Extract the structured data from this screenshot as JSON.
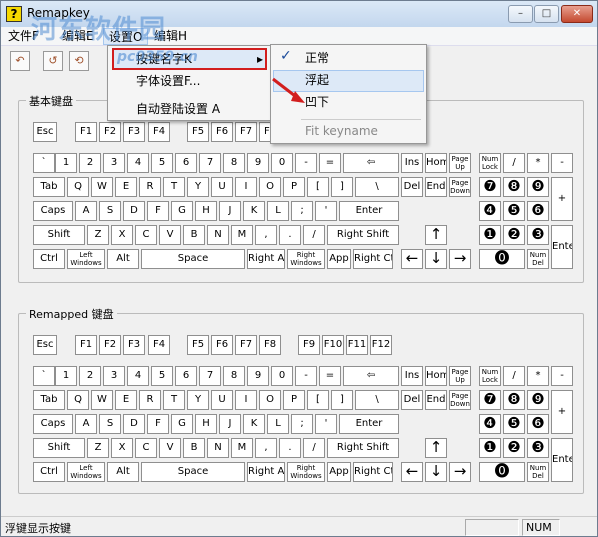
{
  "window": {
    "title": "Remapkey",
    "icon_glyph": "?",
    "min": "–",
    "max": "□",
    "close": "✕"
  },
  "watermark": {
    "text": "河东软件园",
    "url": "pc0359.cn"
  },
  "menubar": [
    "文件F",
    "编辑E",
    "设置O",
    "编辑H"
  ],
  "toolbar": [
    {
      "icon": "open-icon",
      "glyph": "↶"
    },
    {
      "icon": "undo-icon",
      "glyph": "↺"
    },
    {
      "icon": "redo-icon",
      "glyph": "⟲"
    }
  ],
  "settings_menu": {
    "items": [
      "按键名字K",
      "字体设置F...",
      "自动登陆设置 A"
    ],
    "submenu_arrow": "▸"
  },
  "keyname_submenu": {
    "items": [
      "正常",
      "浮起",
      "凹下",
      "Fit keyname"
    ],
    "checked_glyph": "✓"
  },
  "groups": {
    "base_title": "基本键盘",
    "remapped_title": "Remapped 键盘"
  },
  "status": {
    "text": "浮键显示按键",
    "num": "NUM"
  },
  "keys": {
    "fn": [
      "Esc",
      "F1",
      "F2",
      "F3",
      "F4",
      "F5",
      "F6",
      "F7",
      "F8",
      "F9",
      "F10",
      "F11",
      "F12"
    ],
    "row1": [
      "`",
      "1",
      "2",
      "3",
      "4",
      "5",
      "6",
      "7",
      "8",
      "9",
      "0",
      "-",
      "=",
      "⇦"
    ],
    "row2": [
      "Tab",
      "Q",
      "W",
      "E",
      "R",
      "T",
      "Y",
      "U",
      "I",
      "O",
      "P",
      "[",
      "]",
      "\\"
    ],
    "row3": [
      "Caps",
      "A",
      "S",
      "D",
      "F",
      "G",
      "H",
      "J",
      "K",
      "L",
      ";",
      "'",
      "Enter"
    ],
    "row4": [
      "Shift",
      "Z",
      "X",
      "C",
      "V",
      "B",
      "N",
      "M",
      ",",
      ".",
      "/",
      "Right Shift"
    ],
    "row5": [
      "Ctrl",
      "Left Windows",
      "Alt",
      "Space",
      "Right Alt",
      "Right Windows",
      "App",
      "Right Ctrl"
    ],
    "nav1": [
      "Ins",
      "Home",
      "Page Up"
    ],
    "nav2": [
      "Del",
      "End",
      "Page Down"
    ],
    "arrows": [
      "↑",
      "←",
      "↓",
      "→"
    ],
    "num1": [
      "Num Lock",
      "/",
      "*",
      "-"
    ],
    "num2": [
      "❼",
      "❽",
      "❾",
      "+"
    ],
    "num3": [
      "❹",
      "❺",
      "❻"
    ],
    "num4": [
      "❶",
      "❷",
      "❸",
      "Enter"
    ],
    "num5": [
      "⓿",
      "Num Del"
    ]
  }
}
